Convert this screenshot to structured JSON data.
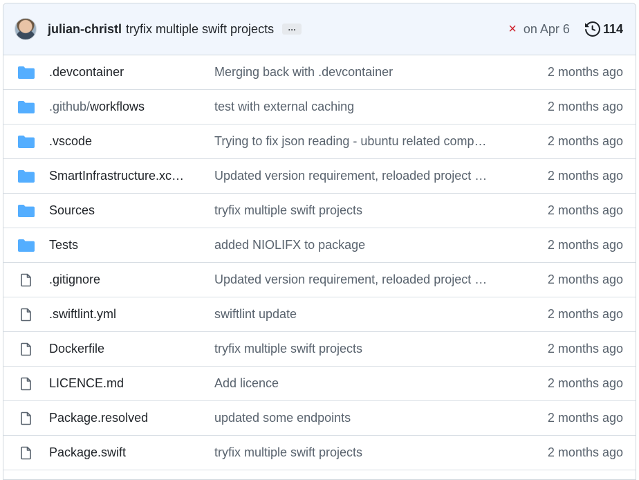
{
  "commit": {
    "author": "julian-christl",
    "message": "tryfix multiple swift projects",
    "ellipsis": "…",
    "status": "×",
    "date": "on Apr 6",
    "history_count": "114"
  },
  "files": [
    {
      "type": "folder",
      "prefix": "",
      "name": ".devcontainer",
      "message": "Merging back with .devcontainer",
      "age": "2 months ago"
    },
    {
      "type": "folder",
      "prefix": ".github/",
      "name": "workflows",
      "message": "test with external caching",
      "age": "2 months ago"
    },
    {
      "type": "folder",
      "prefix": "",
      "name": ".vscode",
      "message": "Trying to fix json reading - ubuntu related comp…",
      "age": "2 months ago"
    },
    {
      "type": "folder",
      "prefix": "",
      "name": "SmartInfrastructure.xc…",
      "message": "Updated version requirement, reloaded project …",
      "age": "2 months ago"
    },
    {
      "type": "folder",
      "prefix": "",
      "name": "Sources",
      "message": "tryfix multiple swift projects",
      "age": "2 months ago"
    },
    {
      "type": "folder",
      "prefix": "",
      "name": "Tests",
      "message": "added NIOLIFX to package",
      "age": "2 months ago"
    },
    {
      "type": "file",
      "prefix": "",
      "name": ".gitignore",
      "message": "Updated version requirement, reloaded project …",
      "age": "2 months ago"
    },
    {
      "type": "file",
      "prefix": "",
      "name": ".swiftlint.yml",
      "message": "swiftlint update",
      "age": "2 months ago"
    },
    {
      "type": "file",
      "prefix": "",
      "name": "Dockerfile",
      "message": "tryfix multiple swift projects",
      "age": "2 months ago"
    },
    {
      "type": "file",
      "prefix": "",
      "name": "LICENCE.md",
      "message": "Add licence",
      "age": "2 months ago"
    },
    {
      "type": "file",
      "prefix": "",
      "name": "Package.resolved",
      "message": "updated some endpoints",
      "age": "2 months ago"
    },
    {
      "type": "file",
      "prefix": "",
      "name": "Package.swift",
      "message": "tryfix multiple swift projects",
      "age": "2 months ago"
    }
  ],
  "colors": {
    "folder": "#54aeff",
    "file_outline": "#59636e",
    "status_fail": "#cf222e",
    "header_bg": "#f1f6fd"
  },
  "icons": {
    "folder": "folder-icon",
    "file": "file-icon",
    "history": "history-icon",
    "status": "x-icon"
  }
}
